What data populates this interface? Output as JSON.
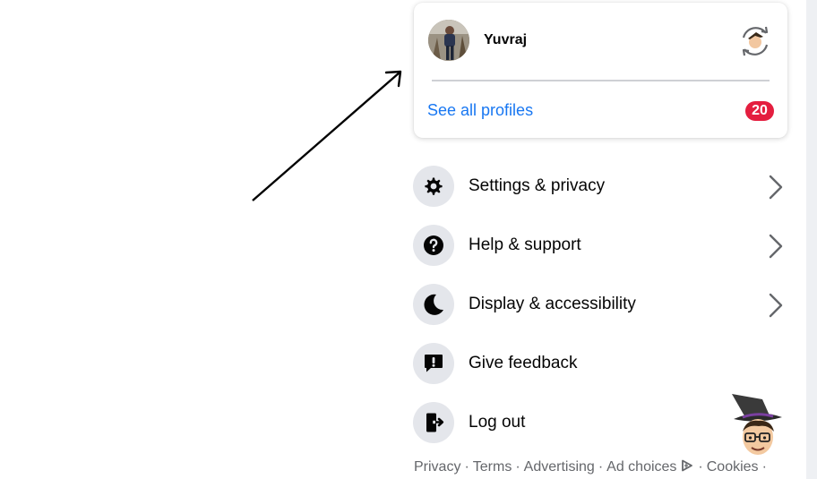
{
  "profile": {
    "name": "Yuvraj",
    "see_all_label": "See all profiles",
    "profile_count": "20"
  },
  "menu": [
    {
      "label": "Settings & privacy",
      "icon": "gear-icon",
      "has_chevron": true
    },
    {
      "label": "Help & support",
      "icon": "help-icon",
      "has_chevron": true
    },
    {
      "label": "Display & accessibility",
      "icon": "moon-icon",
      "has_chevron": true
    },
    {
      "label": "Give feedback",
      "icon": "feedback-icon",
      "has_chevron": false
    },
    {
      "label": "Log out",
      "icon": "logout-icon",
      "has_chevron": false
    }
  ],
  "footer": {
    "privacy": "Privacy",
    "terms": "Terms",
    "advertising": "Advertising",
    "ad_choices": "Ad choices",
    "cookies": "Cookies",
    "separator": "·"
  },
  "colors": {
    "link_blue": "#1877f2",
    "badge_red": "#e41e3f",
    "icon_circle": "#e4e6eb",
    "secondary_text": "#65676b"
  }
}
